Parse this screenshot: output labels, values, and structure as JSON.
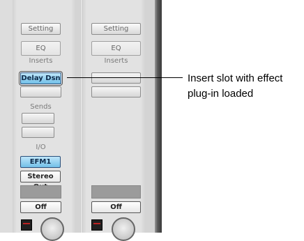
{
  "strip1": {
    "setting": "Setting",
    "eq": "EQ",
    "inserts_label": "Inserts",
    "insert_loaded": "Delay Dsn",
    "sends_label": "Sends",
    "io_label": "I/O",
    "input": "EFM1",
    "output": "Stereo Out",
    "automation": "Off"
  },
  "strip2": {
    "setting": "Setting",
    "eq": "EQ",
    "inserts_label": "Inserts",
    "automation": "Off"
  },
  "callout": {
    "line1": "Insert slot with effect",
    "line2": "plug-in loaded"
  }
}
